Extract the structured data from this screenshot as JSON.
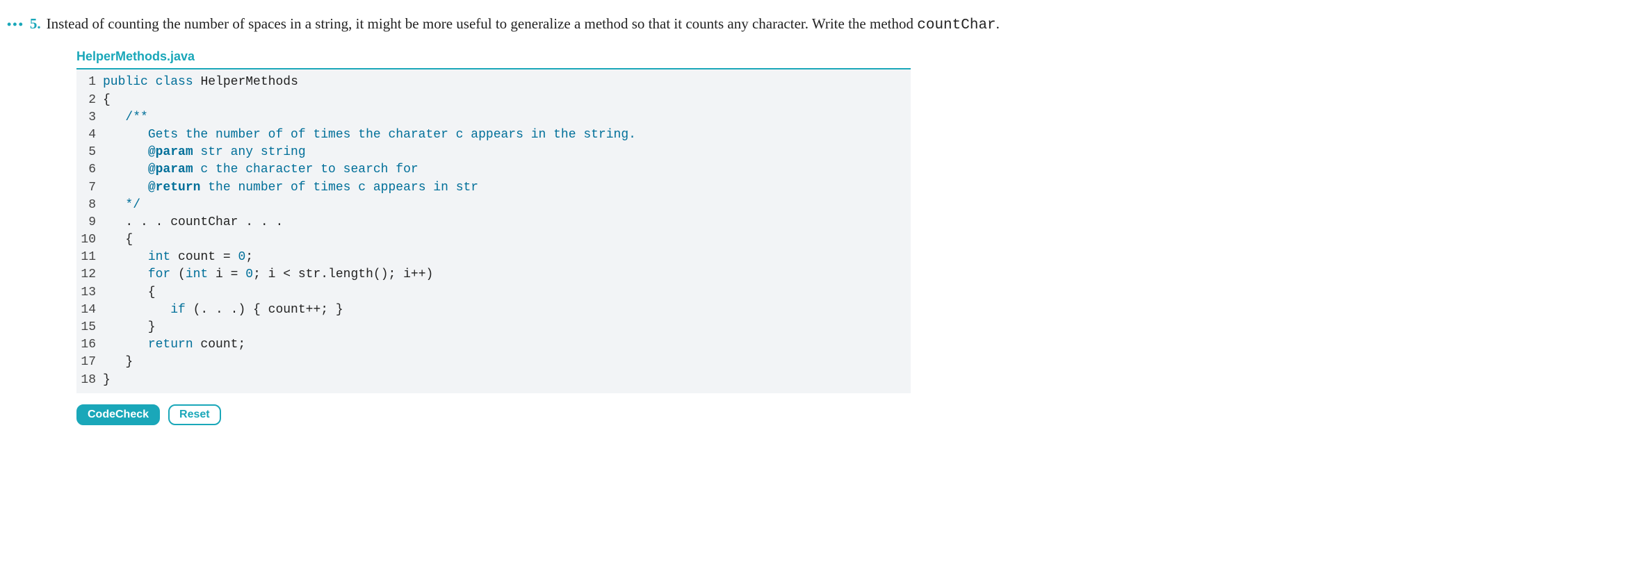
{
  "exercise": {
    "dots": "•••",
    "number": "5.",
    "text_before": "Instead of counting the number of spaces in a string, it might be more useful to generalize a method so that it counts any character. Write the method ",
    "code_word": "countChar",
    "text_after": "."
  },
  "filename": "HelperMethods.java",
  "code": {
    "lines": [
      {
        "n": "1",
        "tokens": [
          [
            "kw",
            "public"
          ],
          [
            "plain",
            " "
          ],
          [
            "kw",
            "class"
          ],
          [
            "plain",
            " HelperMethods"
          ]
        ]
      },
      {
        "n": "2",
        "tokens": [
          [
            "plain",
            "{"
          ]
        ]
      },
      {
        "n": "3",
        "tokens": [
          [
            "plain",
            "   "
          ],
          [
            "cm",
            "/**"
          ]
        ]
      },
      {
        "n": "4",
        "tokens": [
          [
            "plain",
            "      "
          ],
          [
            "cm",
            "Gets the number of of times the charater c appears in the string."
          ]
        ]
      },
      {
        "n": "5",
        "tokens": [
          [
            "plain",
            "      "
          ],
          [
            "cm-tag",
            "@param"
          ],
          [
            "cm",
            " str any string"
          ]
        ]
      },
      {
        "n": "6",
        "tokens": [
          [
            "plain",
            "      "
          ],
          [
            "cm-tag",
            "@param"
          ],
          [
            "cm",
            " c the character to search for"
          ]
        ]
      },
      {
        "n": "7",
        "tokens": [
          [
            "plain",
            "      "
          ],
          [
            "cm-tag",
            "@return"
          ],
          [
            "cm",
            " the number of times c appears in str"
          ]
        ]
      },
      {
        "n": "8",
        "tokens": [
          [
            "plain",
            "   "
          ],
          [
            "cm",
            "*/"
          ]
        ]
      },
      {
        "n": "9",
        "tokens": [
          [
            "plain",
            "   . . . countChar . . ."
          ]
        ]
      },
      {
        "n": "10",
        "tokens": [
          [
            "plain",
            "   {"
          ]
        ]
      },
      {
        "n": "11",
        "tokens": [
          [
            "plain",
            "      "
          ],
          [
            "kw",
            "int"
          ],
          [
            "plain",
            " count = "
          ],
          [
            "num",
            "0"
          ],
          [
            "plain",
            ";"
          ]
        ]
      },
      {
        "n": "12",
        "tokens": [
          [
            "plain",
            "      "
          ],
          [
            "kw",
            "for"
          ],
          [
            "plain",
            " ("
          ],
          [
            "kw",
            "int"
          ],
          [
            "plain",
            " i = "
          ],
          [
            "num",
            "0"
          ],
          [
            "plain",
            "; i < str.length(); i++)"
          ]
        ]
      },
      {
        "n": "13",
        "tokens": [
          [
            "plain",
            "      {"
          ]
        ]
      },
      {
        "n": "14",
        "tokens": [
          [
            "plain",
            "         "
          ],
          [
            "kw",
            "if"
          ],
          [
            "plain",
            " (. . .) { count++; }"
          ]
        ]
      },
      {
        "n": "15",
        "tokens": [
          [
            "plain",
            "      }"
          ]
        ]
      },
      {
        "n": "16",
        "tokens": [
          [
            "plain",
            "      "
          ],
          [
            "kw",
            "return"
          ],
          [
            "plain",
            " count;"
          ]
        ]
      },
      {
        "n": "17",
        "tokens": [
          [
            "plain",
            "   }"
          ]
        ]
      },
      {
        "n": "18",
        "tokens": [
          [
            "plain",
            "}"
          ]
        ]
      }
    ]
  },
  "buttons": {
    "codecheck": "CodeCheck",
    "reset": "Reset"
  }
}
